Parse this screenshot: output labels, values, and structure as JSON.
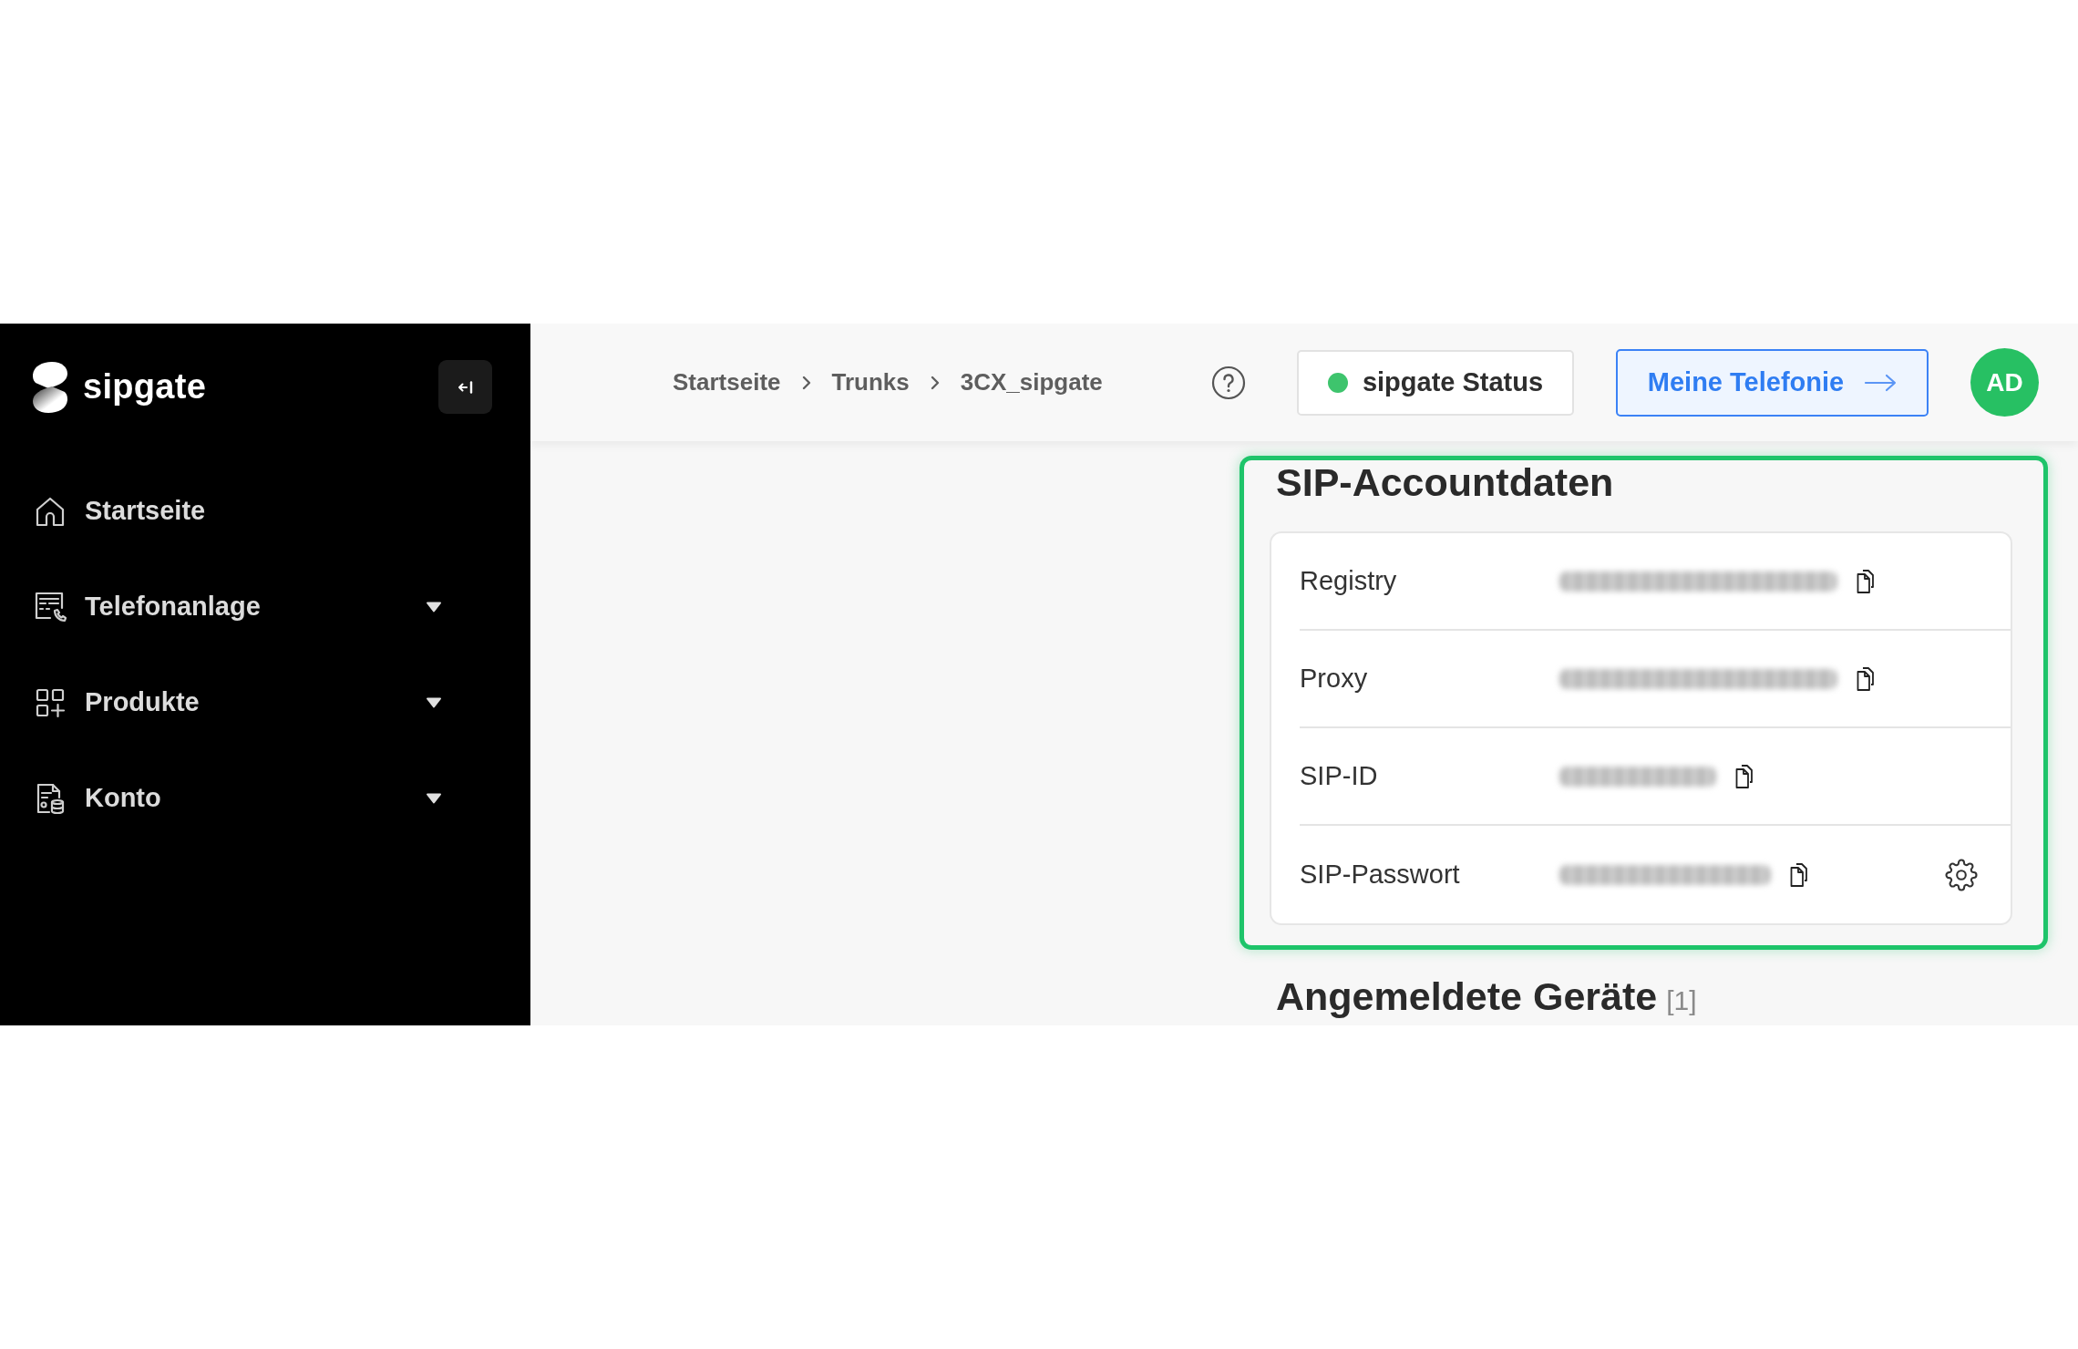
{
  "sidebar": {
    "logo_text": "sipgate",
    "items": [
      {
        "label": "Startseite",
        "kind": "link"
      },
      {
        "label": "Telefonanlage",
        "kind": "menu"
      },
      {
        "label": "Produkte",
        "kind": "menu"
      },
      {
        "label": "Konto",
        "kind": "menu"
      }
    ]
  },
  "header": {
    "breadcrumb": [
      "Startseite",
      "Trunks",
      "3CX_sipgate"
    ],
    "status_button": {
      "label": "sipgate Status"
    },
    "primary_button": {
      "label": "Meine Telefonie"
    },
    "avatar": {
      "initials": "AD"
    }
  },
  "sip_account": {
    "title": "SIP-Accountdaten",
    "highlighted": true,
    "rows": [
      {
        "label": "Registry",
        "kind": "copy"
      },
      {
        "label": "Proxy",
        "kind": "copy"
      },
      {
        "label": "SIP-ID",
        "kind": "copy"
      },
      {
        "label": "SIP-Passwort",
        "kind": "copy-settings"
      }
    ]
  },
  "devices": {
    "title": "Angemeldete Geräte",
    "count": "[1]"
  }
}
